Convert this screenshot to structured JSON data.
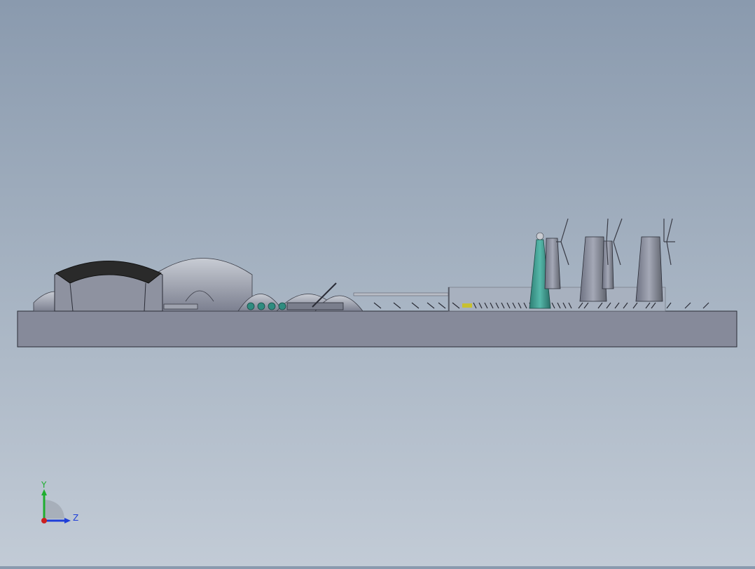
{
  "app": {
    "view": "cad-3d-viewport"
  },
  "scene": {
    "background_top": "#8a9aae",
    "background_bottom": "#c2cbd6",
    "base_color": "#868a9a",
    "building_color": "#8e92a0",
    "roof_color": "#2a2a2a",
    "teal_color": "#3a9a8e",
    "highlight_color": "#c8c030",
    "icons": [
      "wind-turbine-icon",
      "storage-dome-icon",
      "chimney-icon"
    ]
  },
  "triad": {
    "y_label": "Y",
    "z_label": "Z",
    "y_color": "#1fae2f",
    "z_color": "#1f3fd8",
    "x_color": "#cc2020"
  }
}
